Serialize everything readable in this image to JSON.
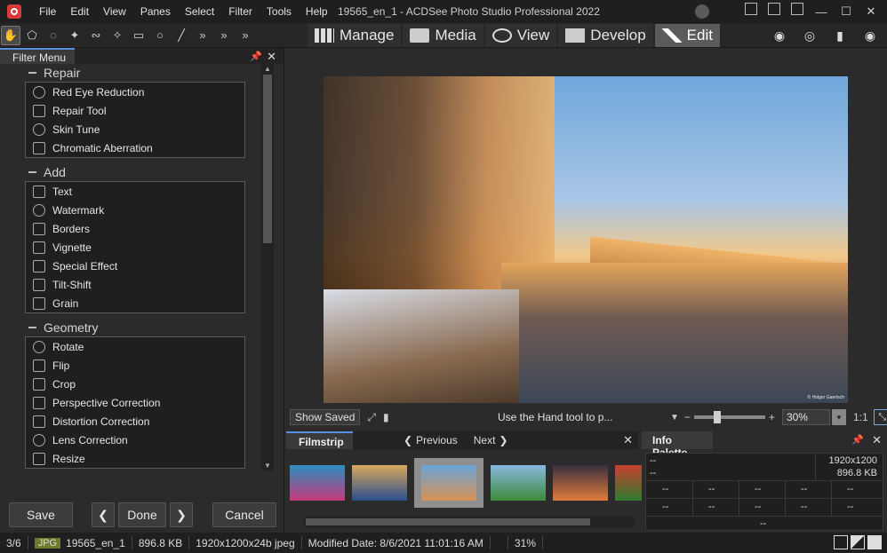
{
  "titlebar": {
    "menus": [
      "File",
      "Edit",
      "View",
      "Panes",
      "Select",
      "Filter",
      "Tools",
      "Help"
    ],
    "title": "19565_en_1 - ACDSee Photo Studio Professional 2022",
    "controls": {
      "minimize": "—",
      "maximize": "☐",
      "close": "✕"
    }
  },
  "modes": [
    {
      "label": "Manage",
      "icon": "grid-icon"
    },
    {
      "label": "Media",
      "icon": "media-icon"
    },
    {
      "label": "View",
      "icon": "eye-icon"
    },
    {
      "label": "Develop",
      "icon": "develop-icon"
    },
    {
      "label": "Edit",
      "icon": "edit-icon",
      "active": true
    }
  ],
  "extra_icons": [
    "film-reel-icon",
    "365-icon",
    "bar-chart-icon",
    "eye-swirl-icon"
  ],
  "filter_menu": {
    "tab": "Filter Menu",
    "sections": [
      {
        "title": "Repair",
        "items": [
          "Red Eye Reduction",
          "Repair Tool",
          "Skin Tune",
          "Chromatic Aberration"
        ]
      },
      {
        "title": "Add",
        "items": [
          "Text",
          "Watermark",
          "Borders",
          "Vignette",
          "Special Effect",
          "Tilt-Shift",
          "Grain"
        ]
      },
      {
        "title": "Geometry",
        "items": [
          "Rotate",
          "Flip",
          "Crop",
          "Perspective Correction",
          "Distortion Correction",
          "Lens Correction",
          "Resize"
        ]
      }
    ],
    "buttons": {
      "save": "Save",
      "done": "Done",
      "cancel": "Cancel",
      "prev": "❮",
      "next": "❯"
    }
  },
  "viewer": {
    "credit": "© Holger Gaertsch",
    "show_saved": "Show Saved",
    "hint": "Use the Hand tool to p...",
    "zoom": "30%",
    "ratio": "1:1",
    "zoom_fraction": 0.3
  },
  "filmstrip": {
    "tab": "Filmstrip",
    "previous": "Previous",
    "next": "Next",
    "thumbs": [
      {
        "colors": [
          "#c63a7a",
          "#2c8ec0"
        ]
      },
      {
        "colors": [
          "#2b4e8f",
          "#d9a85b"
        ]
      },
      {
        "colors": [
          "#d89254",
          "#6aa3d6"
        ],
        "selected": true
      },
      {
        "colors": [
          "#3e8a3a",
          "#88b8e0"
        ]
      },
      {
        "colors": [
          "#e07a3a",
          "#3a3040"
        ]
      },
      {
        "colors": [
          "#2f7a2f",
          "#c8402f"
        ]
      }
    ]
  },
  "info_palette": {
    "tab": "Info Palette",
    "row1_left": "--",
    "row1_right": "1920x1200",
    "row2_left": "--",
    "row2_right": "896.8 KB",
    "grid_placeholder": "--",
    "footer": "--"
  },
  "status": {
    "position": "3/6",
    "format": "JPG",
    "filename": "19565_en_1",
    "size": "896.8 KB",
    "dims": "1920x1200x24b jpeg",
    "modified": "Modified Date: 8/6/2021 11:01:16 AM",
    "zoom": "31%"
  }
}
